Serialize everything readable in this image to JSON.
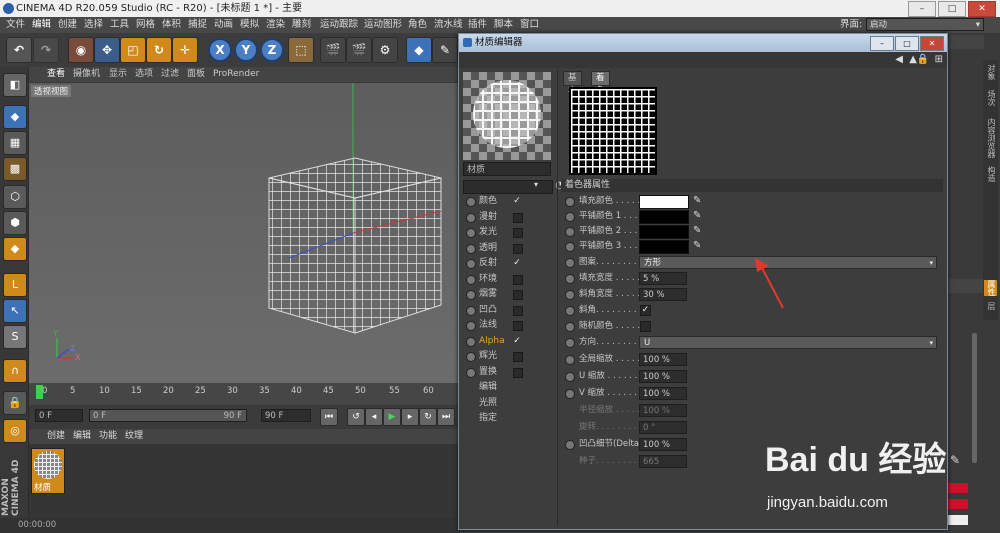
{
  "app": {
    "title": "CINEMA 4D R20.059 Studio (RC - R20) - [未标题 1 *] - 主要",
    "layout_label": "界面:",
    "layout_value": "启动"
  },
  "menubar": [
    "文件",
    "编辑",
    "创建",
    "选择",
    "工具",
    "网格",
    "体积",
    "捕捉",
    "动画",
    "模拟",
    "渲染",
    "雕刻",
    "运动跟踪",
    "运动图形",
    "角色",
    "流水线",
    "插件",
    "脚本",
    "窗口"
  ],
  "toolbar": {
    "axis_x": "X",
    "axis_y": "Y",
    "axis_z": "Z"
  },
  "viewport": {
    "menu": [
      "查看",
      "摄像机",
      "显示",
      "选项",
      "过滤",
      "面板",
      "ProRender"
    ],
    "label": "透视视图",
    "axis_labels": {
      "y": "Y",
      "z": "Z",
      "x": "X"
    }
  },
  "timeline": {
    "ticks": [
      "0",
      "5",
      "10",
      "15",
      "20",
      "25",
      "30",
      "35",
      "40",
      "45",
      "50",
      "55",
      "60"
    ],
    "start": "0 F",
    "current": "0 F",
    "end": "90 F",
    "end2": "90 F"
  },
  "material_manager": {
    "menu": [
      "创建",
      "编辑",
      "功能",
      "纹理"
    ],
    "material_label": "材质"
  },
  "statusbar": {
    "time": "00:00:00"
  },
  "maxon": "MAXON CINEMA 4D",
  "dialog": {
    "title": "材质编辑器",
    "material_name": "材质",
    "channels": [
      {
        "label": "颜色",
        "checked": true,
        "highlight": false
      },
      {
        "label": "漫射",
        "checked": false,
        "highlight": false
      },
      {
        "label": "发光",
        "checked": false,
        "highlight": false
      },
      {
        "label": "透明",
        "checked": false,
        "highlight": false
      },
      {
        "label": "反射",
        "checked": true,
        "highlight": false
      },
      {
        "label": "环境",
        "checked": false,
        "highlight": false
      },
      {
        "label": "烟雾",
        "checked": false,
        "highlight": false
      },
      {
        "label": "凹凸",
        "checked": false,
        "highlight": false
      },
      {
        "label": "法线",
        "checked": false,
        "highlight": false
      },
      {
        "label": "Alpha",
        "checked": true,
        "highlight": true
      },
      {
        "label": "辉光",
        "checked": false,
        "highlight": false
      },
      {
        "label": "置换",
        "checked": false,
        "highlight": false
      },
      {
        "label": "编辑",
        "checked": null,
        "highlight": false
      },
      {
        "label": "光照",
        "checked": null,
        "highlight": false
      },
      {
        "label": "指定",
        "checked": null,
        "highlight": false
      }
    ],
    "tabs": [
      "基本",
      "着色器"
    ],
    "section_title": "着色器属性",
    "props": {
      "fill_color": "填充颜色 . . . . .",
      "line_color1": "平铺颜色 1 . . .",
      "line_color2": "平铺颜色 2 . . .",
      "line_color3": "平铺颜色 3 . . .",
      "pattern": "图案. . . . . . . . .",
      "pattern_value": "方形",
      "fill_width": "填充宽度 . . . . .",
      "fill_width_value": "5 %",
      "bevel_width": "斜角宽度 . . . . .",
      "bevel_width_value": "30 %",
      "bevel": "斜角. . . . . . . . .",
      "random_color": "随机颜色 . . . . .",
      "orientation": "方向. . . . . . . . .",
      "orientation_value": "U",
      "global_scale": "全局缩放 . . . . .",
      "global_scale_value": "100 %",
      "u_scale": "U 缩放 . . . . . .",
      "u_scale_value": "100 %",
      "v_scale": "V 缩放 . . . . . .",
      "v_scale_value": "100 %",
      "radius_scale": "半径缩放 . . . . .",
      "radius_scale_value": "100 %",
      "rotation": "旋转. . . . . . . . .",
      "rotation_value": "0 °",
      "bump_detail": "凹凸细节(Delta)",
      "bump_detail_value": "100 %",
      "seed": "种子. . . . . . . . .",
      "seed_value": "665"
    },
    "colors": {
      "fill": "#ffffff",
      "tile": "#000000"
    }
  },
  "right_tabs": [
    "对象",
    "场次",
    "内容浏览器",
    "构造",
    "属性",
    "层"
  ],
  "watermark": {
    "big": "Bai du 经验",
    "small": "jingyan.baidu.com"
  }
}
